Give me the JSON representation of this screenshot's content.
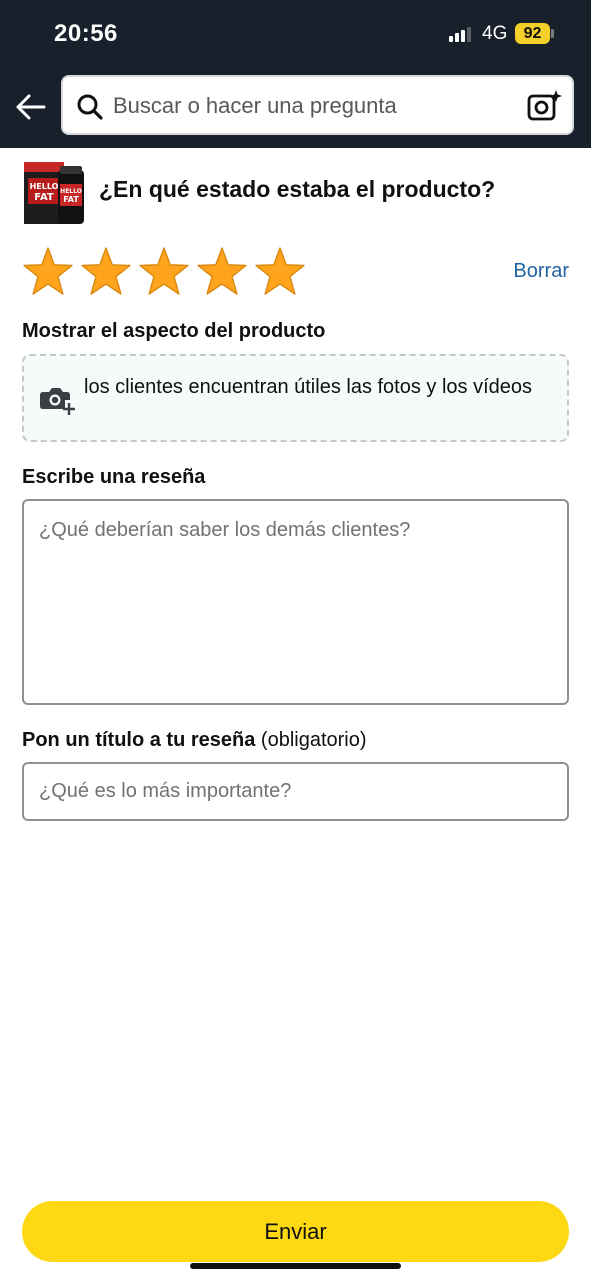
{
  "status_bar": {
    "time": "20:56",
    "network": "4G",
    "battery": "92",
    "signal_bars_active": 3,
    "signal_bars_total": 4,
    "battery_color": "#f3d02a"
  },
  "header": {
    "back_icon": "arrow-left-icon",
    "search_placeholder": "Buscar o hacer una pregunta",
    "search_icon": "search-icon",
    "camera_icon": "camera-sparkle-icon",
    "background_color": "#18202b"
  },
  "product": {
    "thumbnail_text": "HELLO FAT",
    "question": "¿En qué estado estaba el producto?"
  },
  "rating": {
    "value": 5,
    "max": 5,
    "star_color": "#ffa41c",
    "clear_label": "Borrar"
  },
  "media": {
    "label": "Mostrar el aspecto del producto",
    "icon": "camera-plus-icon",
    "text": "los clientes encuentran útiles las fotos y los vídeos"
  },
  "review": {
    "label": "Escribe una reseña",
    "placeholder": "¿Qué deberían saber los demás clientes?",
    "value": ""
  },
  "title_field": {
    "label": "Pon un título a tu reseña",
    "label_suffix": "(obligatorio)",
    "placeholder": "¿Qué es lo más importante?",
    "value": ""
  },
  "submit": {
    "label": "Enviar",
    "color": "#ffd814"
  }
}
